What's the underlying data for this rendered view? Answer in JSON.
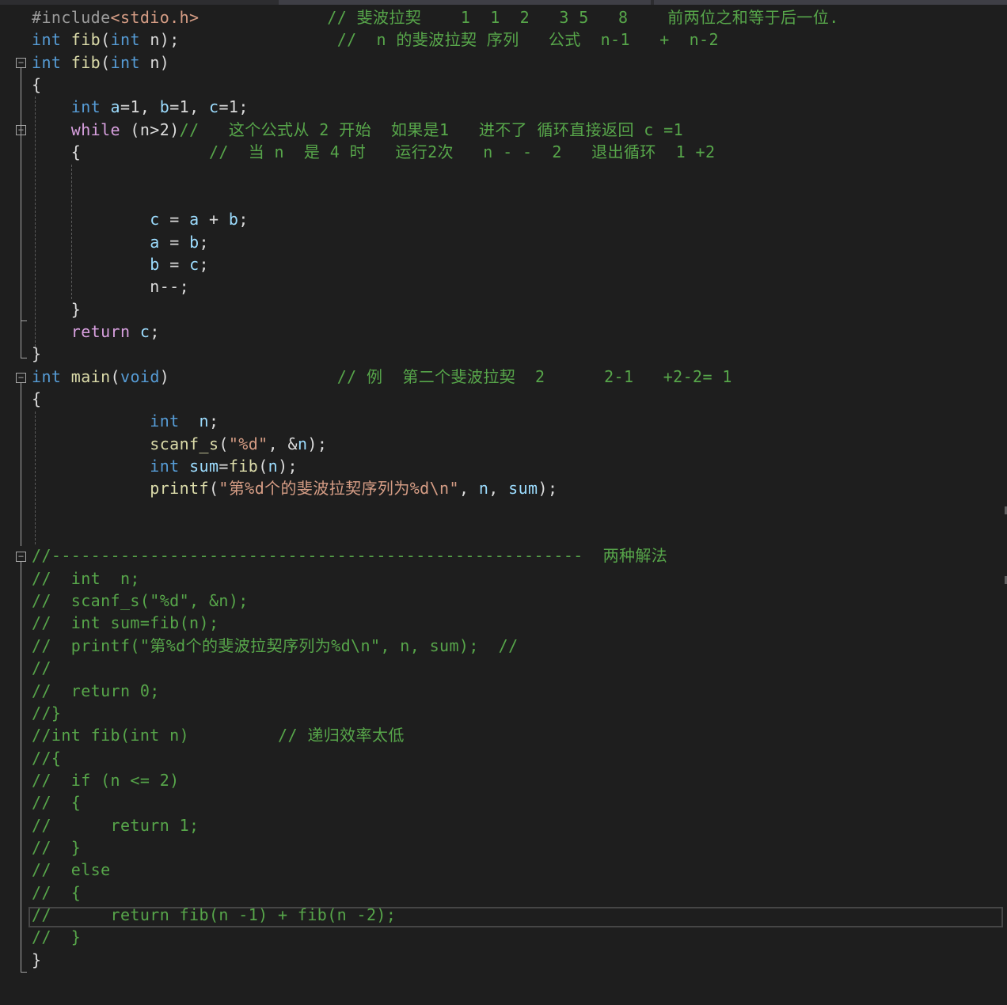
{
  "editor": {
    "language": "C",
    "colors": {
      "background": "#1e1e1e",
      "keyword": "#569cd6",
      "control": "#d8a0df",
      "function": "#dcdcaa",
      "variable": "#9cdcfe",
      "string": "#d69d85",
      "comment": "#57a64a",
      "plain": "#dcdcdc"
    },
    "lines": [
      [
        [
          "pp",
          "#include"
        ],
        [
          "hd",
          "<stdio.h>"
        ],
        [
          "p",
          "             "
        ],
        [
          "cm",
          "// 斐波拉契    1  1  2   3 5   8    前两位之和等于后一位."
        ]
      ],
      [
        [
          "kw",
          "int"
        ],
        [
          "p",
          " "
        ],
        [
          "fn",
          "fib"
        ],
        [
          "p",
          "("
        ],
        [
          "kw",
          "int"
        ],
        [
          "p",
          " n);"
        ],
        [
          "p",
          "                "
        ],
        [
          "cm",
          "//  n 的斐波拉契 序列   公式  n-1   +  n-2"
        ]
      ],
      [
        [
          "kw",
          "int"
        ],
        [
          "p",
          " "
        ],
        [
          "fn",
          "fib"
        ],
        [
          "p",
          "("
        ],
        [
          "kw",
          "int"
        ],
        [
          "p",
          " n)"
        ]
      ],
      [
        [
          "p",
          "{"
        ]
      ],
      [
        [
          "p",
          "    "
        ],
        [
          "kw",
          "int"
        ],
        [
          "p",
          " "
        ],
        [
          "var",
          "a"
        ],
        [
          "p",
          "=1, "
        ],
        [
          "var",
          "b"
        ],
        [
          "p",
          "=1, "
        ],
        [
          "var",
          "c"
        ],
        [
          "p",
          "=1;"
        ]
      ],
      [
        [
          "p",
          "    "
        ],
        [
          "kw2",
          "while"
        ],
        [
          "p",
          " (n>2)"
        ],
        [
          "cm",
          "//   这个公式从 2 开始  如果是1   进不了 循环直接返回 c =1"
        ]
      ],
      [
        [
          "p",
          "    {"
        ],
        [
          "p",
          "             "
        ],
        [
          "cm",
          "//  当 n  是 4 时   运行2次   n - -  2   退出循环  1 +2"
        ]
      ],
      [
        [
          "p",
          ""
        ]
      ],
      [
        [
          "p",
          ""
        ]
      ],
      [
        [
          "p",
          "            "
        ],
        [
          "var",
          "c"
        ],
        [
          "p",
          " = "
        ],
        [
          "var",
          "a"
        ],
        [
          "p",
          " + "
        ],
        [
          "var",
          "b"
        ],
        [
          "p",
          ";"
        ]
      ],
      [
        [
          "p",
          "            "
        ],
        [
          "var",
          "a"
        ],
        [
          "p",
          " = "
        ],
        [
          "var",
          "b"
        ],
        [
          "p",
          ";"
        ]
      ],
      [
        [
          "p",
          "            "
        ],
        [
          "var",
          "b"
        ],
        [
          "p",
          " = "
        ],
        [
          "var",
          "c"
        ],
        [
          "p",
          ";"
        ]
      ],
      [
        [
          "p",
          "            n--;"
        ]
      ],
      [
        [
          "p",
          "    }"
        ]
      ],
      [
        [
          "p",
          "    "
        ],
        [
          "kw2",
          "return"
        ],
        [
          "p",
          " "
        ],
        [
          "var",
          "c"
        ],
        [
          "p",
          ";"
        ]
      ],
      [
        [
          "p",
          "}"
        ]
      ],
      [
        [
          "kw",
          "int"
        ],
        [
          "p",
          " "
        ],
        [
          "fn",
          "main"
        ],
        [
          "p",
          "("
        ],
        [
          "kw",
          "void"
        ],
        [
          "p",
          ")"
        ],
        [
          "p",
          "                 "
        ],
        [
          "cm",
          "// 例  第二个斐波拉契  2      2-1   +2-2= 1"
        ]
      ],
      [
        [
          "p",
          "{"
        ]
      ],
      [
        [
          "p",
          "            "
        ],
        [
          "kw",
          "int"
        ],
        [
          "p",
          "  "
        ],
        [
          "var",
          "n"
        ],
        [
          "p",
          ";"
        ]
      ],
      [
        [
          "p",
          "            "
        ],
        [
          "fn",
          "scanf_s"
        ],
        [
          "p",
          "("
        ],
        [
          "str",
          "\"%d\""
        ],
        [
          "p",
          ", &"
        ],
        [
          "var",
          "n"
        ],
        [
          "p",
          ");"
        ]
      ],
      [
        [
          "p",
          "            "
        ],
        [
          "kw",
          "int"
        ],
        [
          "p",
          " "
        ],
        [
          "var",
          "sum"
        ],
        [
          "p",
          "="
        ],
        [
          "fn",
          "fib"
        ],
        [
          "p",
          "("
        ],
        [
          "var",
          "n"
        ],
        [
          "p",
          ");"
        ]
      ],
      [
        [
          "p",
          "            "
        ],
        [
          "fn",
          "printf"
        ],
        [
          "p",
          "("
        ],
        [
          "str",
          "\"第%d个的斐波拉契序列为%d\\n\""
        ],
        [
          "p",
          ", "
        ],
        [
          "var",
          "n"
        ],
        [
          "p",
          ", "
        ],
        [
          "var",
          "sum"
        ],
        [
          "p",
          ");"
        ]
      ],
      [
        [
          "p",
          ""
        ]
      ],
      [
        [
          "p",
          ""
        ]
      ],
      [
        [
          "cm",
          "//------------------------------------------------------  两种解法"
        ]
      ],
      [
        [
          "cm",
          "//  int  n;"
        ]
      ],
      [
        [
          "cm",
          "//  scanf_s(\"%d\", &n);"
        ]
      ],
      [
        [
          "cm",
          "//  int sum=fib(n);"
        ]
      ],
      [
        [
          "cm",
          "//  printf(\"第%d个的斐波拉契序列为%d\\n\", n, sum);  //"
        ]
      ],
      [
        [
          "cm",
          "//"
        ]
      ],
      [
        [
          "cm",
          "//  return 0;"
        ]
      ],
      [
        [
          "cm",
          "//}"
        ]
      ],
      [
        [
          "cm",
          "//int fib(int n)         // 递归效率太低"
        ]
      ],
      [
        [
          "cm",
          "//{"
        ]
      ],
      [
        [
          "cm",
          "//  if (n <= 2)"
        ]
      ],
      [
        [
          "cm",
          "//  {"
        ]
      ],
      [
        [
          "cm",
          "//      return 1;"
        ]
      ],
      [
        [
          "cm",
          "//  }"
        ]
      ],
      [
        [
          "cm",
          "//  else"
        ]
      ],
      [
        [
          "cm",
          "//  {"
        ]
      ],
      [
        [
          "cm",
          "//      return fib(n -1) + fib(n -2);"
        ]
      ],
      [
        [
          "cm",
          "//  }"
        ]
      ],
      [
        [
          "p",
          "}"
        ]
      ]
    ]
  }
}
